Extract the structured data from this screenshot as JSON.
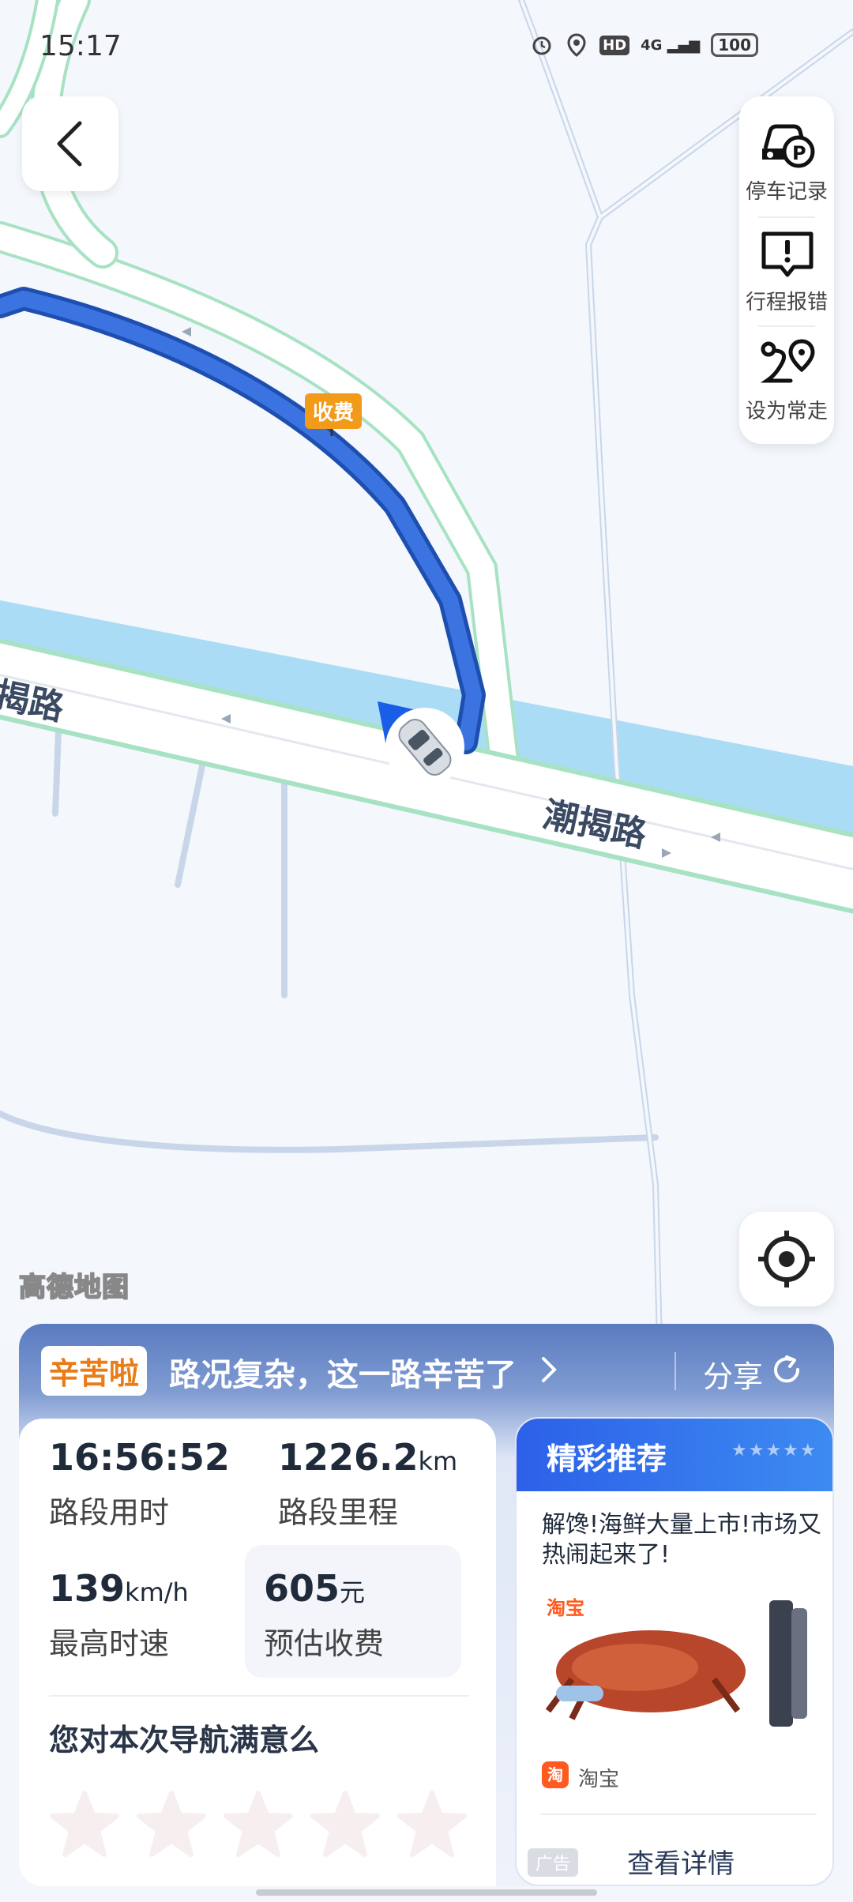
{
  "status_bar": {
    "time": "15:17",
    "hd": "HD",
    "network": "4G",
    "battery": "100"
  },
  "side_panel": {
    "parking_label": "停车记录",
    "report_label": "行程报错",
    "frequent_label": "设为常走"
  },
  "map": {
    "road_name": "潮揭路",
    "road_name_left": "揭路",
    "toll_badge": "收费",
    "logo": "高德地图",
    "colors": {
      "route": "#2f64d6",
      "water": "#aadcf5",
      "road_edge": "#a7e2c3"
    }
  },
  "summary": {
    "banner_tag": "辛苦啦",
    "banner_text": "路况复杂，这一路辛苦了",
    "share_label": "分享"
  },
  "stats": {
    "duration_value": "16:56:52",
    "duration_label": "路段用时",
    "distance_value": "1226.2",
    "distance_unit": "km",
    "distance_label": "路段里程",
    "max_speed_value": "139",
    "max_speed_unit": "km/h",
    "max_speed_label": "最高时速",
    "toll_value": "605",
    "toll_unit": "元",
    "toll_label": "预估收费",
    "rating_question": "您对本次导航满意么"
  },
  "recommend": {
    "title": "精彩推荐",
    "stars": "★★★★★",
    "description": "解馋!海鲜大量上市!市场又热闹起来了!",
    "image_brand": "淘宝",
    "source_icon": "淘",
    "source_name": "淘宝",
    "ad_tag": "广告",
    "more_label": "查看详情"
  }
}
